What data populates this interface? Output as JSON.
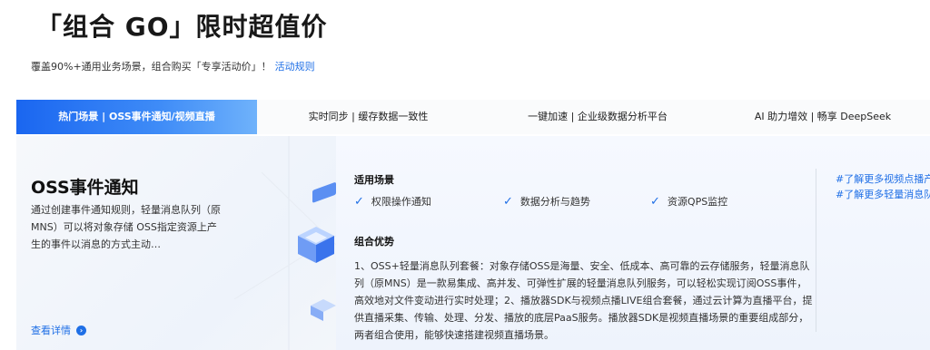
{
  "header": {
    "title": "「组合 GO」限时超值价",
    "subtitle": "覆盖90%+通用业务场景，组合购买「专享活动价」！",
    "rules_link": "活动规则"
  },
  "tabs": [
    {
      "label": "热门场景 | OSS事件通知/视频直播",
      "active": true
    },
    {
      "label": "实时同步 | 缓存数据一致性",
      "active": false
    },
    {
      "label": "一键加速 | 企业级数据分析平台",
      "active": false
    },
    {
      "label": "AI 助力增效 | 畅享 DeepSeek",
      "active": false
    }
  ],
  "card": {
    "title": "OSS事件通知",
    "description": "通过创建事件通知规则，轻量消息队列（原 MNS）可以将对象存储 OSS指定资源上产生的事件以消息的方式主动…",
    "detail_link": "查看详情",
    "detail_icon": "chevron-right-icon"
  },
  "scenarios": {
    "title": "适用场景",
    "items": [
      "权限操作通知",
      "数据分析与趋势",
      "资源QPS监控"
    ],
    "icon": "check-icon"
  },
  "advantages": {
    "title": "组合优势",
    "text": "1、OSS+轻量消息队列套餐：对象存储OSS是海量、安全、低成本、高可靠的云存储服务，轻量消息队列（原MNS）是一款易集成、高并发、可弹性扩展的轻量消息队列服务，可以轻松实现订阅OSS事件，高效地对文件变动进行实时处理；2、播放器SDK与视频点播LIVE组合套餐，通过云计算为直播平台，提供直播采集、传输、处理、分发、播放的底层PaaS服务。播放器SDK是视频直播场景的重要组成部分，两者组合使用，能够快速搭建视频直播场景。"
  },
  "more_links": [
    "#了解更多视频点播产",
    "#了解更多轻量消息队"
  ],
  "colors": {
    "accent": "#1f6fe6",
    "tab_active_start": "#1a66f0",
    "tab_active_end": "#6fb2fb"
  }
}
